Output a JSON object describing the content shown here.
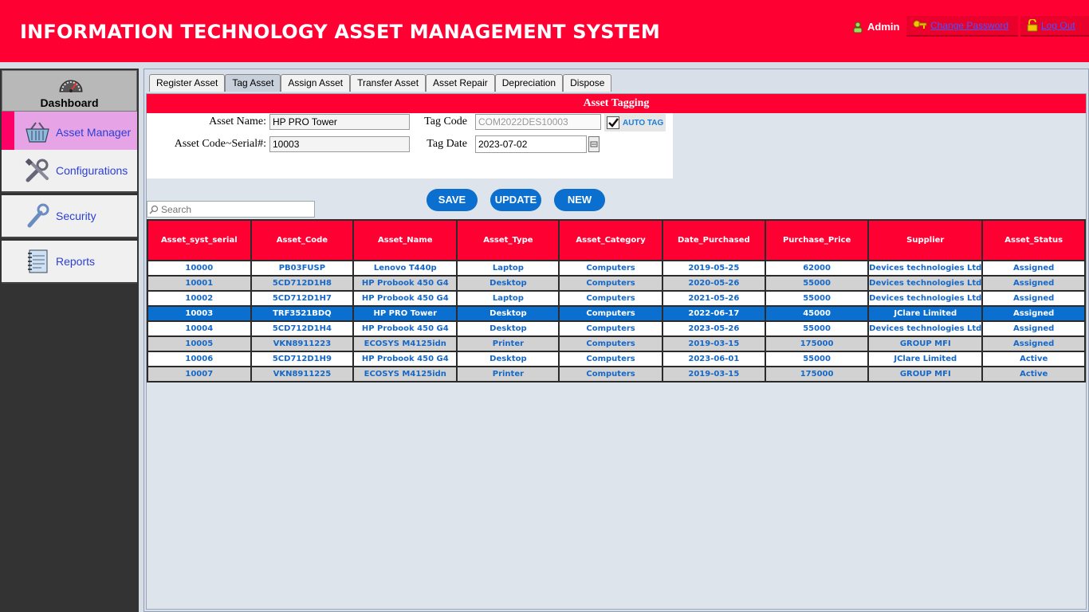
{
  "header": {
    "title": "INFORMATION TECHNOLOGY ASSET MANAGEMENT SYSTEM",
    "user": "Admin",
    "change_password": "Change Password",
    "logout": "Log Out"
  },
  "sidebar": {
    "dashboard": "Dashboard",
    "items": [
      {
        "label": "Asset Manager",
        "icon": "basket-icon"
      },
      {
        "label": "Configurations",
        "icon": "tools-icon"
      },
      {
        "label": "Security",
        "icon": "wrench-icon"
      },
      {
        "label": "Reports",
        "icon": "notebook-icon"
      }
    ]
  },
  "tabs": [
    "Register Asset",
    "Tag Asset",
    "Assign Asset",
    "Transfer Asset",
    "Asset Repair",
    "Depreciation",
    "Dispose"
  ],
  "active_tab": "Tag Asset",
  "form": {
    "title": "Asset Tagging",
    "asset_name_label": "Asset Name:",
    "asset_name": "HP PRO Tower",
    "asset_code_label": "Asset Code~Serial#:",
    "asset_code": "10003",
    "tag_code_label": "Tag Code",
    "tag_code": "COM2022DES10003",
    "auto_tag_label": "AUTO TAG",
    "auto_tag_checked": true,
    "tag_date_label": "Tag Date",
    "tag_date": "2023-07-02"
  },
  "buttons": {
    "save": "SAVE",
    "update": "UPDATE",
    "new": "NEW"
  },
  "search": {
    "placeholder": "Search"
  },
  "table": {
    "columns": [
      "Asset_syst_serial",
      "Asset_Code",
      "Asset_Name",
      "Asset_Type",
      "Asset_Category",
      "Date_Purchased",
      "Purchase_Price",
      "Supplier",
      "Asset_Status"
    ],
    "rows": [
      [
        "10000",
        "PB03FUSP",
        "Lenovo T440p",
        "Laptop",
        "Computers",
        "2019-05-25",
        "62000",
        "Devices technologies Ltd",
        "Assigned"
      ],
      [
        "10001",
        "5CD712D1H8",
        "HP Probook 450 G4",
        "Desktop",
        "Computers",
        "2020-05-26",
        "55000",
        "Devices technologies Ltd",
        "Assigned"
      ],
      [
        "10002",
        "5CD712D1H7",
        "HP Probook 450 G4",
        "Laptop",
        "Computers",
        "2021-05-26",
        "55000",
        "Devices technologies Ltd",
        "Assigned"
      ],
      [
        "10003",
        "TRF3521BDQ",
        "HP PRO Tower",
        "Desktop",
        "Computers",
        "2022-06-17",
        "45000",
        "JClare Limited",
        "Assigned"
      ],
      [
        "10004",
        "5CD712D1H4",
        "HP Probook 450 G4",
        "Desktop",
        "Computers",
        "2023-05-26",
        "55000",
        "Devices technologies Ltd",
        "Assigned"
      ],
      [
        "10005",
        "VKN8911223",
        "ECOSYS M4125idn",
        "Printer",
        "Computers",
        "2019-03-15",
        "175000",
        "GROUP MFI",
        "Assigned"
      ],
      [
        "10006",
        "5CD712D1H9",
        "HP Probook 450 G4",
        "Desktop",
        "Computers",
        "2023-06-01",
        "55000",
        "JClare Limited",
        "Active"
      ],
      [
        "10007",
        "VKN8911225",
        "ECOSYS M4125idn",
        "Printer",
        "Computers",
        "2019-03-15",
        "175000",
        "GROUP MFI",
        "Active"
      ]
    ],
    "selected_row": 3
  },
  "colors": {
    "brand_red": "#ff0033",
    "accent_blue": "#0a6fcf",
    "link_blue": "#1668c8"
  }
}
